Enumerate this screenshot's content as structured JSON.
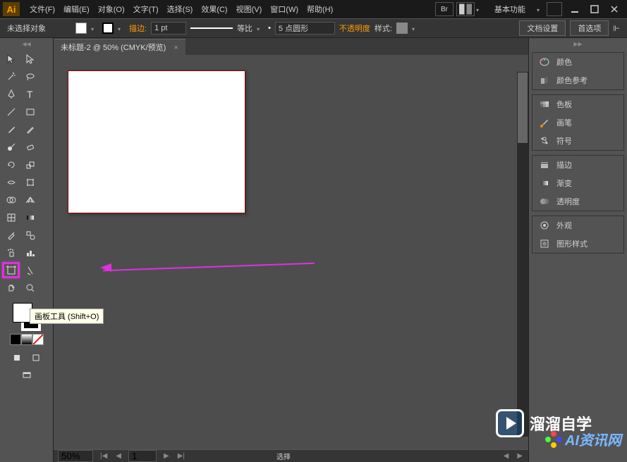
{
  "app": {
    "logo": "Ai"
  },
  "menu": [
    "文件(F)",
    "编辑(E)",
    "对象(O)",
    "文字(T)",
    "选择(S)",
    "效果(C)",
    "视图(V)",
    "窗口(W)",
    "帮助(H)"
  ],
  "title_icons": {
    "br": "Br"
  },
  "workspace": "基本功能",
  "control": {
    "no_selection": "未选择对象",
    "stroke_label": "描边:",
    "stroke_weight": "1 pt",
    "ratio_label": "等比",
    "brush": "5 点圆形",
    "opacity_label": "不透明度",
    "style_label": "样式:",
    "doc_setup": "文档设置",
    "prefs": "首选项"
  },
  "doc": {
    "tab_title": "未标题-2 @ 50% (CMYK/预览)",
    "zoom": "50%",
    "page": "1",
    "mode": "选择"
  },
  "tooltip": "画板工具 (Shift+O)",
  "panels": {
    "color": "颜色",
    "color_guide": "颜色参考",
    "swatches": "色板",
    "brushes": "画笔",
    "symbols": "符号",
    "stroke": "描边",
    "gradient": "渐变",
    "transparency": "透明度",
    "appearance": "外观",
    "graphic_styles": "图形样式"
  },
  "watermark1": "溜溜自学",
  "watermark2": "AI资讯网"
}
